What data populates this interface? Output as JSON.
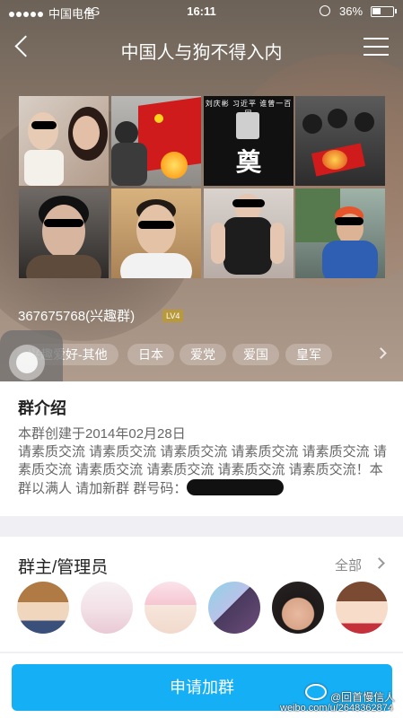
{
  "status_bar": {
    "carrier": "中国电信",
    "network": "4G",
    "time": "16:11",
    "battery": "36%"
  },
  "nav": {
    "title": "中国人与狗不得入内",
    "back_icon": "chevron-left-icon",
    "menu_icon": "hamburger-menu-icon"
  },
  "photos": {
    "mourning_names": "刘庆彬  习近平  谁曾一百同",
    "mourning_char": "奠"
  },
  "group": {
    "id_label": "367675768(兴趣群)",
    "level": "LV4"
  },
  "tags": [
    "兴趣爱好-其他",
    "日本",
    "爱党",
    "爱国",
    "皇军"
  ],
  "intro": {
    "title": "群介绍",
    "text": "本群创建于2014年02月28日\n请素质交流 请素质交流 请素质交流 请素质交流 请素质交流 请素质交流 请素质交流 请素质交流 请素质交流 请素质交流！本群以满人 请加新群 群号码："
  },
  "admins": {
    "title": "群主/管理员",
    "all_label": "全部"
  },
  "join_button": "申请加群",
  "watermark": {
    "name": "@回首慢信人",
    "url": "weibo.com/u/2648362874"
  },
  "colors": {
    "accent": "#14aff5",
    "level_badge": "#b89a3c"
  }
}
